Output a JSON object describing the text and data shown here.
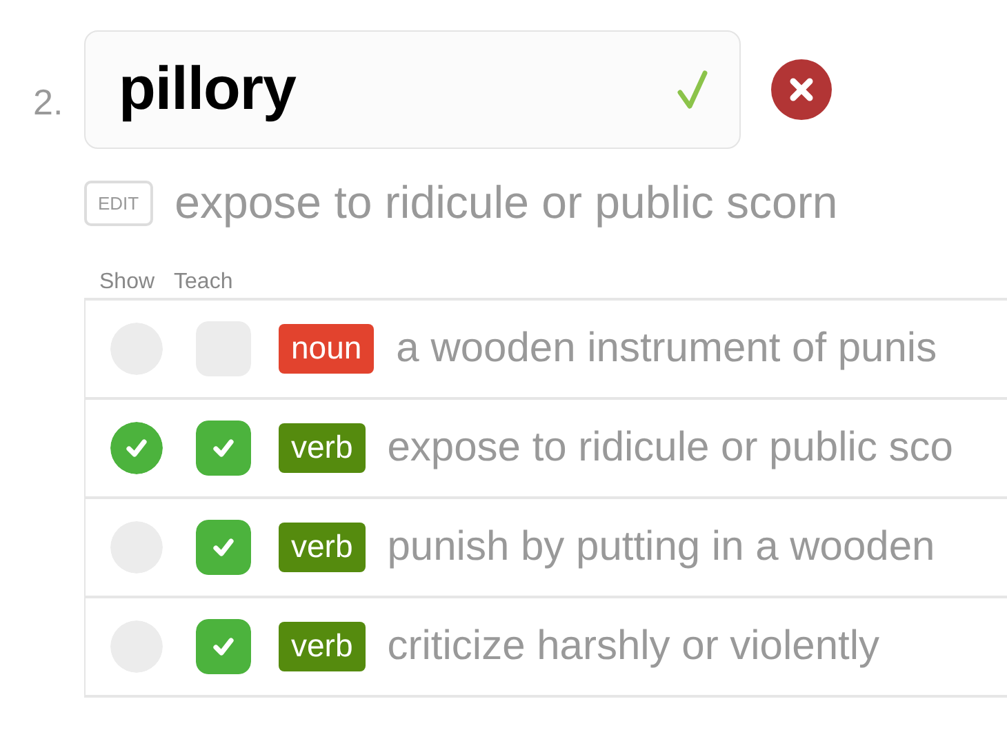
{
  "word": {
    "number": "2.",
    "value": "pillory",
    "correct": true
  },
  "definition": {
    "edit_label": "EDIT",
    "text": "expose to ridicule or public scorn"
  },
  "columns": [
    "Show",
    "Teach"
  ],
  "senses": [
    {
      "show": false,
      "teach": false,
      "pos": "noun",
      "color": "#e2432e",
      "text": "a wooden instrument of punis"
    },
    {
      "show": true,
      "teach": true,
      "pos": "verb",
      "color": "#558b0e",
      "text": "expose to ridicule or public sco"
    },
    {
      "show": false,
      "teach": true,
      "pos": "verb",
      "color": "#558b0e",
      "text": "punish by putting in a wooden"
    },
    {
      "show": false,
      "teach": true,
      "pos": "verb",
      "color": "#558b0e",
      "text": "criticize harshly or violently"
    }
  ]
}
